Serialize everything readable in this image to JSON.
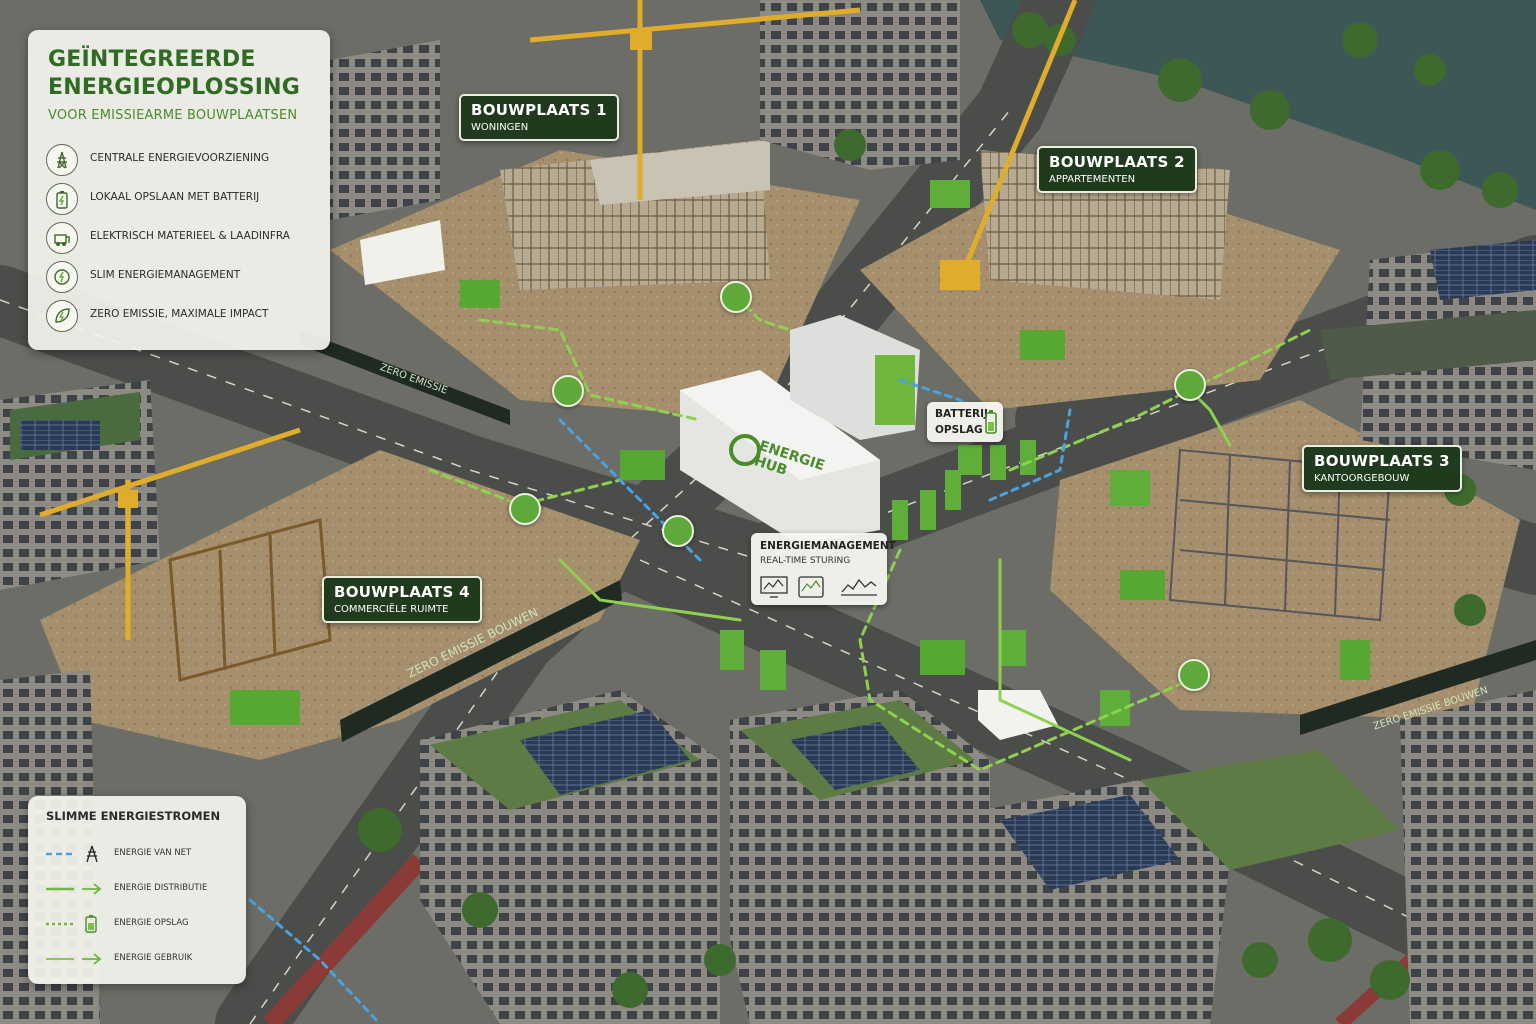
{
  "header": {
    "title": "GEÏNTEGREERDE ENERGIEOPLOSSING",
    "subtitle": "VOOR EMISSIEARME BOUWPLAATSEN"
  },
  "features": [
    {
      "icon": "power-pylon-icon",
      "label": "CENTRALE ENERGIEVOORZIENING"
    },
    {
      "icon": "battery-icon",
      "label": "LOKAAL OPSLAAN MET BATTERIJ"
    },
    {
      "icon": "electric-machine-icon",
      "label": "ELEKTRISCH MATERIEEL & LAADINFRA"
    },
    {
      "icon": "smart-energy-icon",
      "label": "SLIM ENERGIEMANAGEMENT"
    },
    {
      "icon": "leaf-bolt-icon",
      "label": "ZERO EMISSIE, MAXIMALE IMPACT"
    }
  ],
  "sites": [
    {
      "name": "BOUWPLAATS 1",
      "type": "WONINGEN"
    },
    {
      "name": "BOUWPLAATS 2",
      "type": "APPARTEMENTEN"
    },
    {
      "name": "BOUWPLAATS 3",
      "type": "KANTOORGEBOUW"
    },
    {
      "name": "BOUWPLAATS 4",
      "type": "COMMERCIËLE RUIMTE"
    }
  ],
  "hub": {
    "line1": "ENERGIE",
    "line2": "HUB"
  },
  "battery_callout": {
    "line1": "BATTERIJ",
    "line2": "OPSLAG"
  },
  "management_callout": {
    "title": "ENERGIEMANAGEMENT",
    "subtitle": "REAL-TIME STURING"
  },
  "banners": {
    "site4": "ZERO EMISSIE BOUWEN",
    "site1": "ZERO EMISSIE",
    "site3": "ZERO EMISSIE BOUWEN"
  },
  "legend": {
    "title": "SLIMME ENERGIESTROMEN",
    "items": [
      {
        "label": "ENERGIE VAN NET",
        "color": "#4aa3e0",
        "style": "dashed",
        "icon": "power-pylon-icon"
      },
      {
        "label": "ENERGIE DISTRIBUTIE",
        "color": "#7cc242",
        "style": "solid",
        "icon": "arrow-icon"
      },
      {
        "label": "ENERGIE OPSLAG",
        "color": "#7cc242",
        "style": "dotted",
        "icon": "battery-icon"
      },
      {
        "label": "ENERGIE GEBRUIK",
        "color": "#7cc242",
        "style": "solid-thin",
        "icon": "arrow-icon"
      }
    ]
  },
  "colors": {
    "accent_green": "#7cc242",
    "dark_green": "#1f3a1c",
    "grid_blue": "#4aa3e0",
    "title_green": "#2f6b23"
  }
}
